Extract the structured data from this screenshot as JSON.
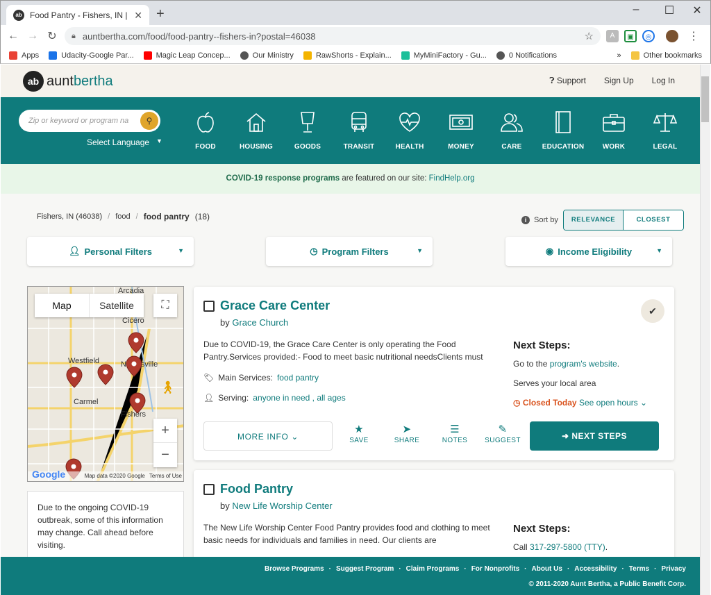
{
  "browser": {
    "tab_title": "Food Pantry - Fishers, IN | Aunt B",
    "url": "auntbertha.com/food/food-pantry--fishers-in?postal=46038",
    "bookmarks": [
      {
        "label": "Apps",
        "color": "#e94235"
      },
      {
        "label": "Udacity-Google Par...",
        "color": "#1a73e8"
      },
      {
        "label": "Magic Leap Concep...",
        "color": "#ff0000"
      },
      {
        "label": "Our Ministry",
        "color": "#555555"
      },
      {
        "label": "RawShorts - Explain...",
        "color": "#f4b400"
      },
      {
        "label": "MyMiniFactory - Gu...",
        "color": "#1dbf9a"
      },
      {
        "label": "0 Notifications",
        "color": "#555555"
      }
    ],
    "overflow": "»",
    "other_bookmarks": "Other bookmarks"
  },
  "header": {
    "logo_mark": "ab",
    "logo_text_1": "aunt",
    "logo_text_2": "bertha",
    "support": "Support",
    "signup": "Sign Up",
    "login": "Log In"
  },
  "search": {
    "placeholder": "Zip or keyword or program na",
    "language": "Select Language"
  },
  "categories": [
    "FOOD",
    "HOUSING",
    "GOODS",
    "TRANSIT",
    "HEALTH",
    "MONEY",
    "CARE",
    "EDUCATION",
    "WORK",
    "LEGAL"
  ],
  "covid": {
    "bold": "COVID-19 response programs",
    "text": " are featured on our site: ",
    "link": "FindHelp.org"
  },
  "breadcrumb": {
    "loc": "Fishers, IN (46038)",
    "cat": "food",
    "current": "food pantry",
    "count": "(18)"
  },
  "sort": {
    "label": "Sort by",
    "relevance": "RELEVANCE",
    "closest": "CLOSEST"
  },
  "filters": {
    "personal": "Personal Filters",
    "program": "Program Filters",
    "income": "Income Eligibility"
  },
  "map": {
    "tab_map": "Map",
    "tab_sat": "Satellite",
    "labels": [
      "Arcadia",
      "Cicero",
      "Westfield",
      "Noblesville",
      "Carmel",
      "Fishers"
    ],
    "footer_data": "Map data ©2020 Google",
    "footer_terms": "Terms of Use",
    "google": "Google"
  },
  "notice": "Due to the ongoing COVID-19 outbreak, some of this information may change. Call ahead before visiting.",
  "results": [
    {
      "title": "Grace Care Center",
      "by_label": "by",
      "by": "Grace Church",
      "desc": "Due to COVID-19, the Grace Care Center is only operating the Food Pantry.Services provided:- Food to meet basic nutritional needsClients must",
      "main_services_label": "Main Services:",
      "main_services": "food pantry",
      "serving_label": "Serving:",
      "serving": "anyone in need , all ages",
      "next_steps": "Next Steps:",
      "step1_pre": "Go to the ",
      "step1_link": "program's website",
      "step1_post": ".",
      "step2": "Serves your local area",
      "closed": "Closed Today",
      "hours": "See open hours"
    },
    {
      "title": "Food Pantry",
      "by_label": "by",
      "by": "New Life Worship Center",
      "desc": "The New Life Worship Center Food Pantry provides food and clothing to meet basic needs for individuals and families in need. Our clients are",
      "next_steps": "Next Steps:",
      "call_pre": "Call ",
      "call_link": "317-297-5800 (TTY)",
      "call_post": "."
    }
  ],
  "actions": {
    "more_info": "MORE INFO",
    "save": "SAVE",
    "share": "SHARE",
    "notes": "NOTES",
    "suggest": "SUGGEST",
    "next_steps": "NEXT STEPS"
  },
  "footer": {
    "links": [
      "Browse Programs",
      "Suggest Program",
      "Claim Programs",
      "For Nonprofits",
      "About Us",
      "Accessibility",
      "Terms",
      "Privacy"
    ],
    "copyright": "© 2011-2020 Aunt Bertha, a Public Benefit Corp."
  },
  "colors": {
    "teal": "#0f7b7c",
    "accent": "#e0a52b",
    "closed": "#d9531e",
    "marker": "#b03a2e"
  }
}
